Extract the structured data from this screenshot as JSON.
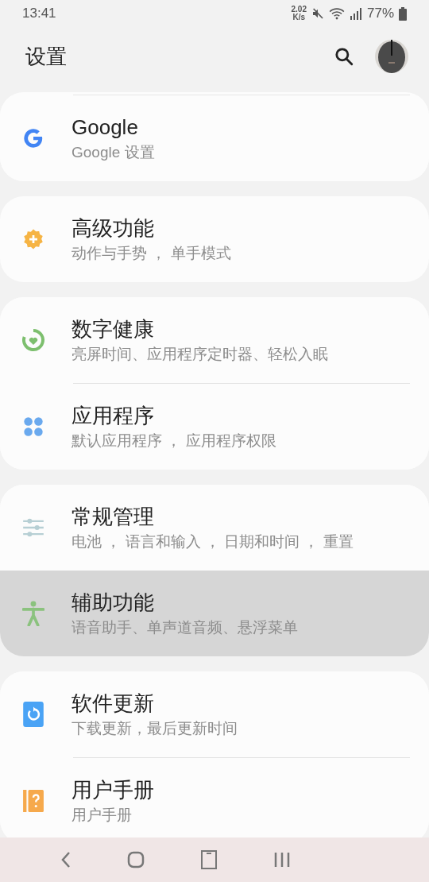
{
  "status_bar": {
    "time": "13:41",
    "net_speed": [
      "2.02",
      "K/s"
    ],
    "battery": "77%"
  },
  "header": {
    "title": "设置"
  },
  "groups": [
    {
      "items": [
        {
          "title": "Google",
          "subtitle": "Google 设置",
          "selected": false
        }
      ]
    },
    {
      "items": [
        {
          "title": "高级功能",
          "subtitle": "动作与手势 ， 单手模式",
          "selected": false
        }
      ]
    },
    {
      "items": [
        {
          "title": "数字健康",
          "subtitle": "亮屏时间、应用程序定时器、轻松入眠",
          "selected": false
        },
        {
          "title": "应用程序",
          "subtitle": "默认应用程序 ， 应用程序权限",
          "selected": false
        }
      ]
    },
    {
      "items": [
        {
          "title": "常规管理",
          "subtitle": "电池 ， 语言和输入 ， 日期和时间 ， 重置",
          "selected": false
        },
        {
          "title": "辅助功能",
          "subtitle": "语音助手、单声道音频、悬浮菜单",
          "selected": true
        }
      ]
    },
    {
      "items": [
        {
          "title": "软件更新",
          "subtitle": "下载更新，最后更新时间",
          "selected": false
        },
        {
          "title": "用户手册",
          "subtitle": "用户手册",
          "selected": false
        }
      ]
    }
  ]
}
